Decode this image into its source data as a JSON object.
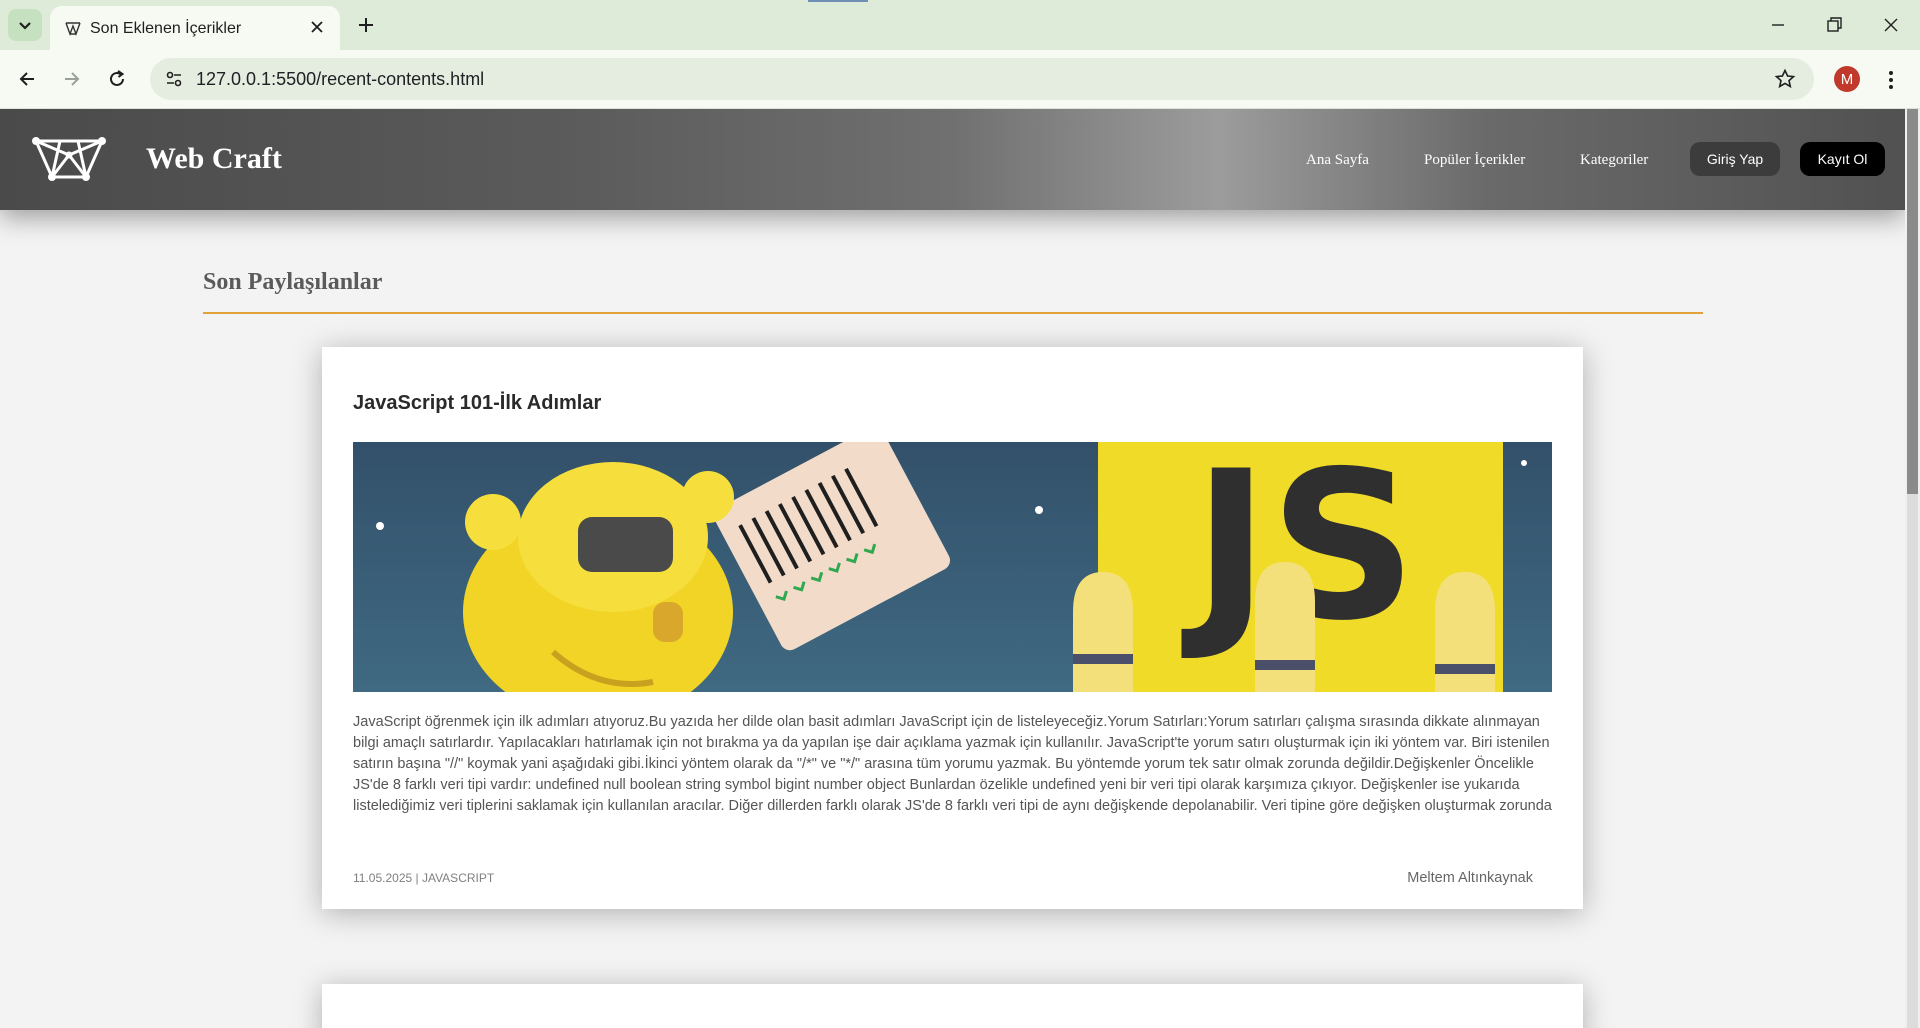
{
  "browser": {
    "tab_title": "Son Eklenen İçerikler",
    "url": "127.0.0.1:5500/recent-contents.html",
    "profile_initial": "M"
  },
  "header": {
    "brand": "Web Craft",
    "nav": [
      "Ana Sayfa",
      "Popüler İçerikler",
      "Kategoriler"
    ],
    "login_label": "Giriş Yap",
    "register_label": "Kayıt Ol"
  },
  "main": {
    "section_title": "Son Paylaşılanlar",
    "posts": [
      {
        "title": "JavaScript 101-İlk Adımlar",
        "excerpt": "JavaScript öğrenmek için ilk adımları atıyoruz.Bu yazıda her dilde olan basit adımları JavaScript için de listeleyeceğiz.Yorum Satırları:Yorum satırları çalışma sırasında dikkate alınmayan bilgi amaçlı satırlardır. Yapılacakları hatırlamak için not bırakma ya da yapılan işe dair açıklama yazmak için kullanılır. JavaScript'te yorum satırı oluşturmak için iki yöntem var. Biri istenilen satırın başına \"//\" koymak yani aşağıdaki gibi.İkinci yöntem olarak da \"/*\" ve \"*/\" arasına tüm yorumu yazmak. Bu yöntemde yorum tek satır olmak zorunda değildir.Değişkenler Öncelikle JS'de 8 farklı veri tipi vardır: undefined null boolean string symbol bigint number object Bunlardan özelikle undefined yeni bir veri tipi olarak karşımıza çıkıyor. Değişkenler ise yukarıda listelediğimiz veri tiplerini saklamak için kullanılan aracılar. Diğer dillerden farklı olarak JS'de 8 farklı veri tipi de aynı değişkende depolanabilir. Veri tipine göre değişken oluşturmak zorunda değiliz yani. Aşağıdaki şekilde \"var\" + \"değişken_ismi\" kombinasyonu ile değişken oluşturabiliriz.Değişken ismi olarak tek dikkat edilmesi",
        "meta": "11.05.2025 | JAVASCRIPT",
        "author": "Meltem Altınkaynak",
        "image_text": "JS"
      }
    ]
  },
  "colors": {
    "accent_rule": "#e2a23a",
    "image_background": "#3b5f77",
    "js_yellow": "#f0dc28"
  }
}
